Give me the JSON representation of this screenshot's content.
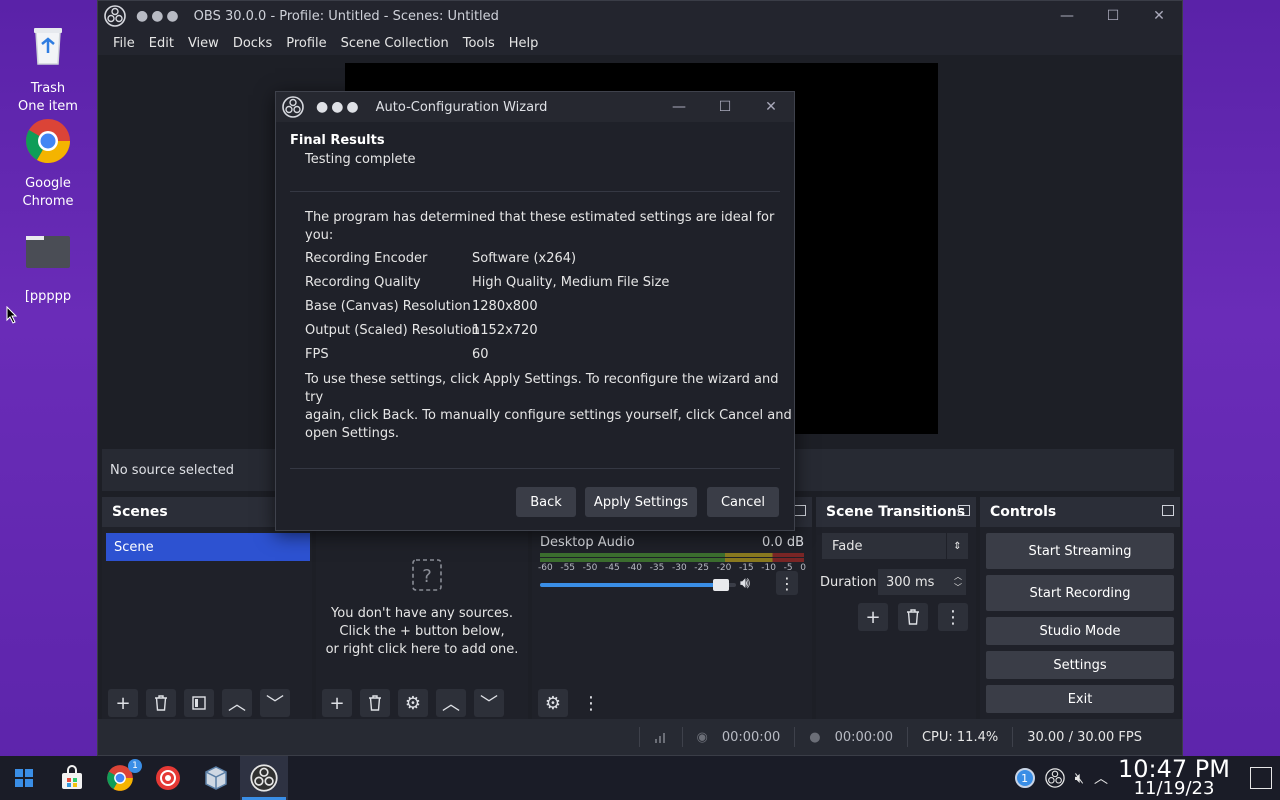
{
  "desktop": {
    "icons": [
      {
        "label1": "Trash",
        "label2": "One item"
      },
      {
        "label1": "Google",
        "label2": "Chrome"
      },
      {
        "label1": "[ppppp",
        "label2": ""
      }
    ]
  },
  "obs": {
    "title": "OBS 30.0.0 - Profile: Untitled - Scenes: Untitled",
    "menu": [
      "File",
      "Edit",
      "View",
      "Docks",
      "Profile",
      "Scene Collection",
      "Tools",
      "Help"
    ],
    "source_status": "No source selected",
    "scenes": {
      "title": "Scenes",
      "items": [
        "Scene"
      ]
    },
    "sources": {
      "empty_line1": "You don't have any sources.",
      "empty_line2": "Click the + button below,",
      "empty_line3": "or right click here to add one."
    },
    "mixer": {
      "channel": "Desktop Audio",
      "level": "0.0 dB",
      "scale": [
        "-60",
        "-55",
        "-50",
        "-45",
        "-40",
        "-35",
        "-30",
        "-25",
        "-20",
        "-15",
        "-10",
        "-5",
        "0"
      ],
      "volume": 0.96
    },
    "transitions": {
      "title": "Scene Transitions",
      "selected": "Fade",
      "duration_label": "Duration",
      "duration_value": "300 ms"
    },
    "controls": {
      "title": "Controls",
      "start_streaming": "Start Streaming",
      "start_recording": "Start Recording",
      "studio_mode": "Studio Mode",
      "settings": "Settings",
      "exit": "Exit"
    },
    "status": {
      "stream_time": "00:00:00",
      "rec_time": "00:00:00",
      "cpu": "CPU: 11.4%",
      "fps": "30.00 / 30.00 FPS"
    }
  },
  "dialog": {
    "title": "Auto-Configuration Wizard",
    "section": "Final Results",
    "subtitle": "Testing complete",
    "intro_line1": "The program has determined that these estimated settings are ideal for",
    "intro_line2": "you:",
    "rows": [
      {
        "label": "Recording Encoder",
        "value": "Software (x264)"
      },
      {
        "label": "Recording Quality",
        "value": "High Quality, Medium File Size"
      },
      {
        "label": "Base (Canvas) Resolution",
        "value": "1280x800"
      },
      {
        "label": "Output (Scaled) Resolution",
        "value": "1152x720"
      },
      {
        "label": "FPS",
        "value": "60"
      }
    ],
    "help_line1": "To use these settings, click Apply Settings. To reconfigure the wizard and try",
    "help_line2": "again, click Back. To manually configure settings yourself, click Cancel and",
    "help_line3": "open Settings.",
    "back": "Back",
    "apply": "Apply Settings",
    "cancel": "Cancel"
  },
  "taskbar": {
    "chrome_badge": "1",
    "tray_badge": "1",
    "time": "10:47 PM",
    "date": "11/19/23"
  }
}
